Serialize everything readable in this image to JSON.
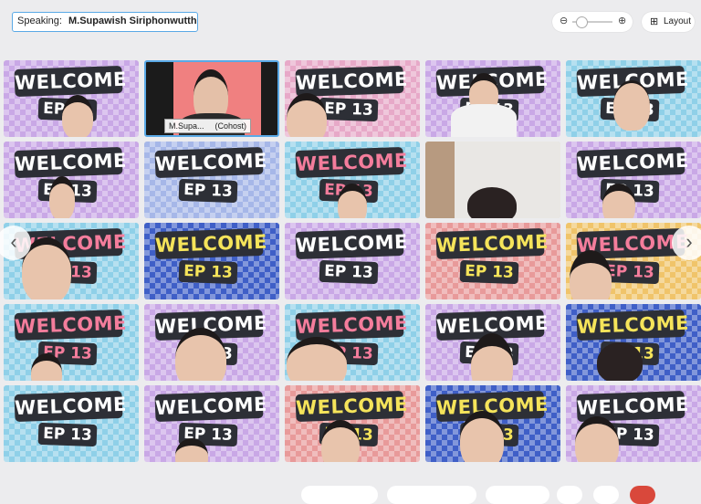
{
  "speaking": {
    "label": "Speaking:",
    "name": "M.Supawish Siriphonwutthi..."
  },
  "zoom": {
    "minus_icon": "zoom-out-icon",
    "plus_icon": "zoom-in-icon"
  },
  "layout": {
    "label": "Layout"
  },
  "tile_text": {
    "welcome": "WELCOME",
    "ep": "EP 13"
  },
  "cohost": {
    "name": "M.Supa...",
    "role": "(Cohost)"
  },
  "nav": {
    "prev": "‹",
    "next": "›"
  }
}
